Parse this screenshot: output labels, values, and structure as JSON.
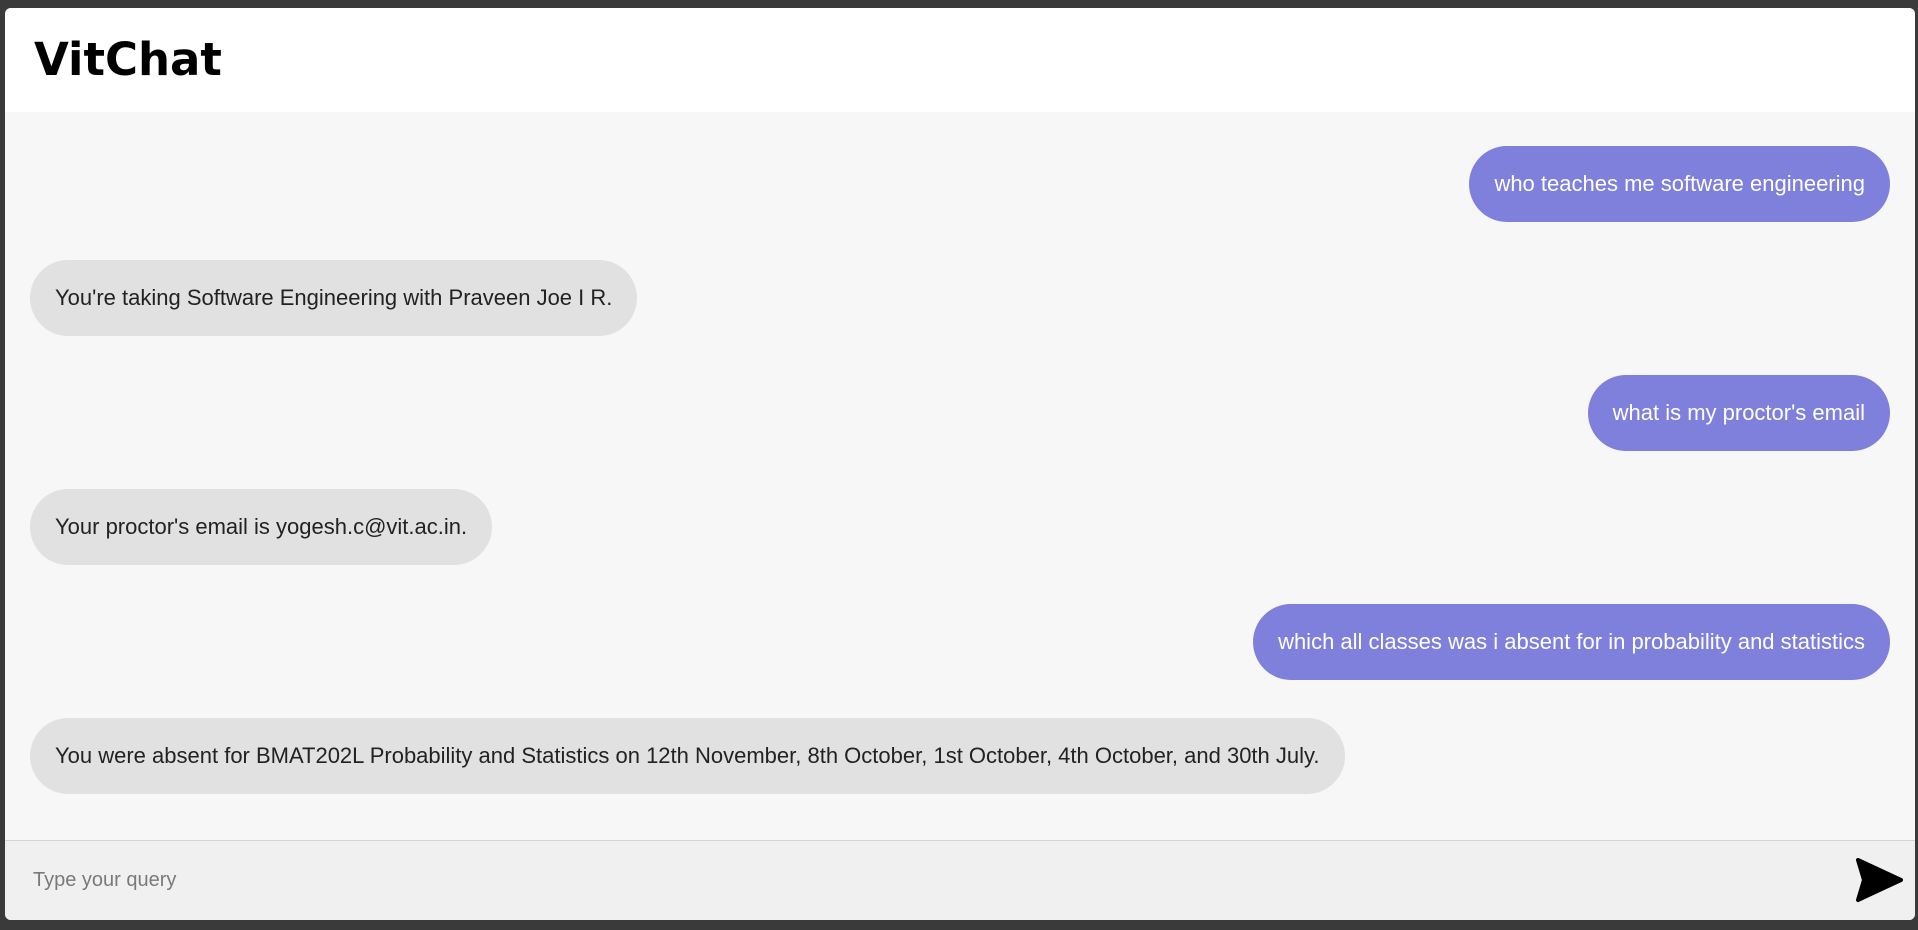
{
  "app": {
    "title": "VitChat"
  },
  "chat": {
    "messages": [
      {
        "role": "user",
        "text": "who teaches me software engineering"
      },
      {
        "role": "bot",
        "text": "You're taking Software Engineering with Praveen Joe I R."
      },
      {
        "role": "user",
        "text": "what is my proctor's email"
      },
      {
        "role": "bot",
        "text": "Your proctor's email is yogesh.c@vit.ac.in."
      },
      {
        "role": "user",
        "text": "which all classes was i absent for in probability and statistics"
      },
      {
        "role": "bot",
        "text": "You were absent for BMAT202L Probability and Statistics on 12th November, 8th October, 1st October, 4th October, and 30th July."
      }
    ]
  },
  "input": {
    "placeholder": "Type your query",
    "value": ""
  },
  "icons": {
    "send": "send-icon"
  },
  "colors": {
    "user_bubble": "#7f7fdc",
    "bot_bubble": "#e1e1e1",
    "chat_background": "#f7f7f7",
    "header_background": "#ffffff",
    "input_background": "#f0f0f0"
  }
}
